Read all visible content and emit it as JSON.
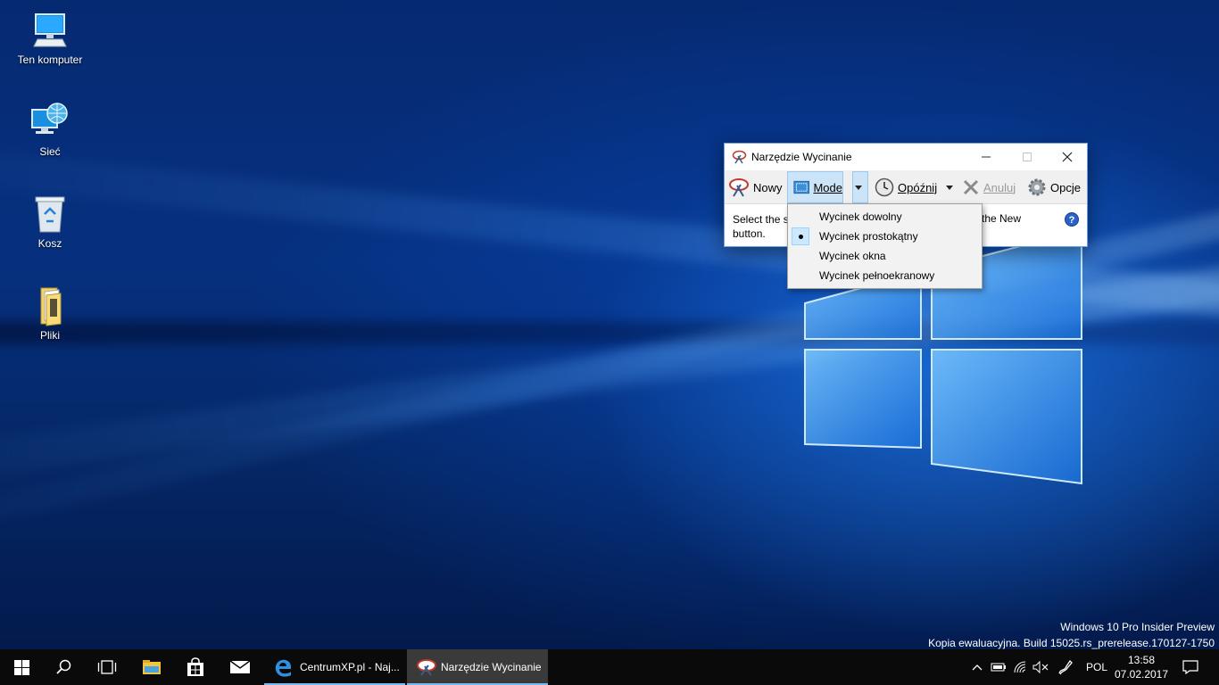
{
  "desktop": {
    "icons": [
      {
        "label": "Ten komputer"
      },
      {
        "label": "Sieć"
      },
      {
        "label": "Kosz"
      },
      {
        "label": "Pliki"
      }
    ]
  },
  "snipping_tool": {
    "title": "Narzędzie Wycinanie",
    "toolbar": {
      "new_label": "Nowy",
      "mode_label": "Mode",
      "delay_label": "Opóźnij",
      "cancel_label": "Anuluj",
      "options_label": "Opcje"
    },
    "body_left": "Select the s",
    "body_left_line2": "button.",
    "body_right": "the New",
    "help_glyph": "?"
  },
  "mode_menu": {
    "items": [
      {
        "label": "Wycinek dowolny",
        "selected": false
      },
      {
        "label": "Wycinek prostokątny",
        "selected": true
      },
      {
        "label": "Wycinek okna",
        "selected": false
      },
      {
        "label": "Wycinek pełnoekranowy",
        "selected": false
      }
    ]
  },
  "watermark": {
    "line1": "Windows 10 Pro Insider Preview",
    "line2": "Kopia ewaluacyjna. Build 15025.rs_prerelease.170127-1750"
  },
  "taskbar": {
    "apps": [
      {
        "label": "CentrumXP.pl - Naj..."
      },
      {
        "label": "Narzędzie Wycinanie"
      }
    ],
    "language": "POL",
    "time": "13:58",
    "date": "07.02.2017"
  },
  "colors": {
    "accent": "#76b9ed",
    "menu_highlight": "#cce8ff",
    "taskbar": "#0a0a0a"
  }
}
